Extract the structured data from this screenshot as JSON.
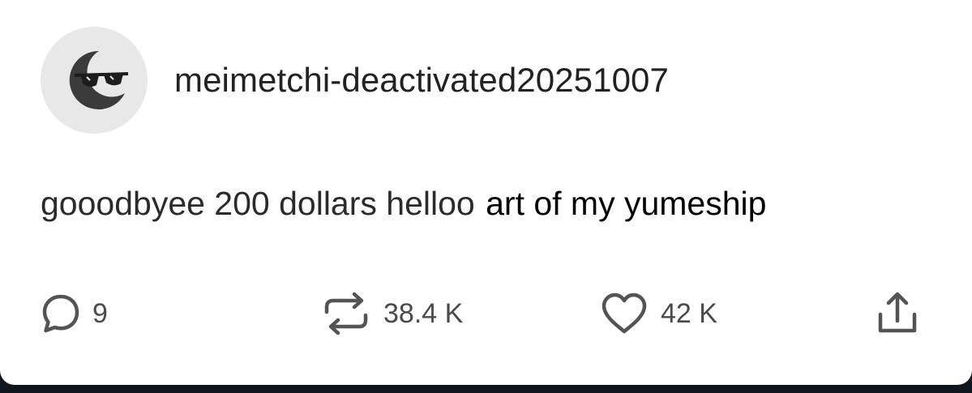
{
  "post": {
    "username": "meimetchi-deactivated20251007",
    "text_part1": "gooodbyee 200 dollars helloo",
    "text_part2": "art of my yumeship"
  },
  "actions": {
    "replies": "9",
    "reblogs": "38.4 K",
    "likes": "42 K"
  },
  "icons": {
    "avatar": "moon-with-sunglasses-icon",
    "reply": "speech-bubble-icon",
    "reblog": "reblog-arrows-icon",
    "like": "heart-icon",
    "share": "share-upload-icon"
  },
  "colors": {
    "background": "#ffffff",
    "avatar_bg": "#e8e8e8",
    "text": "#222222",
    "icon": "#545454",
    "frame": "#10151d"
  }
}
